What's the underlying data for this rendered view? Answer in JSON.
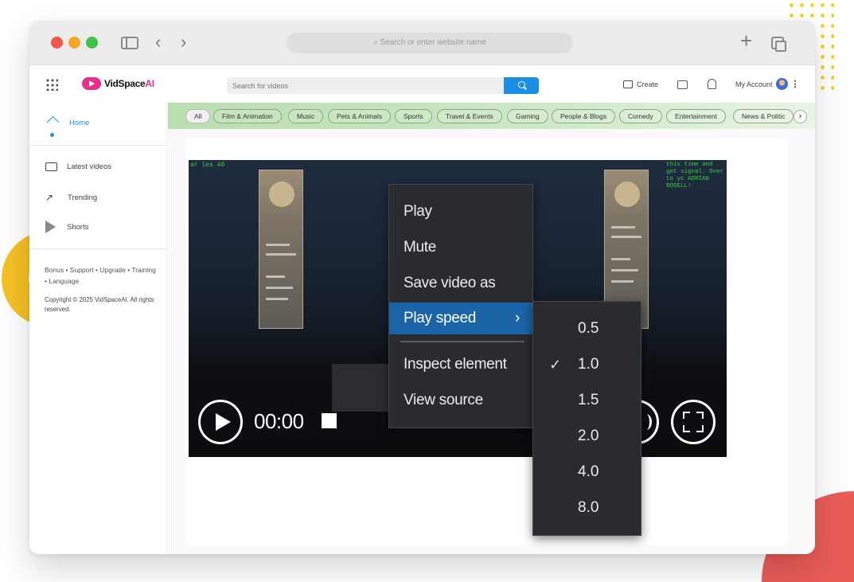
{
  "browser": {
    "url_placeholder": "Search or enter website name"
  },
  "header": {
    "logo_text": "VidSpace",
    "logo_ai": "AI",
    "search_placeholder": "Search for videos",
    "create_label": "Create",
    "account_label": "My Account"
  },
  "sidebar": {
    "items": [
      {
        "label": "Home",
        "icon": "home-icon",
        "active": true
      },
      {
        "label": "Latest videos",
        "icon": "video-icon"
      },
      {
        "label": "Trending",
        "icon": "trending-icon"
      },
      {
        "label": "Shorts",
        "icon": "shorts-icon"
      }
    ],
    "links": "Bonus • Support • Upgrade • Training • Language",
    "copyright": "Copyright © 2025 VidSpaceAI. All rights reserved."
  },
  "chips": [
    "All",
    "Film & Animation",
    "Music",
    "Pets & Animals",
    "Sports",
    "Travel & Events",
    "Gaming",
    "People & Blogs",
    "Comedy",
    "Entertainment",
    "News & Politic"
  ],
  "video": {
    "overlay_left": "ar les 40",
    "overlay_right": "this time and get signal. Over to yc ADRIAN ROSELL!",
    "time": "00:00"
  },
  "context_menu": {
    "items": [
      "Play",
      "Mute",
      "Save video as",
      "Play speed",
      "Inspect element",
      "View source"
    ],
    "highlighted": "Play speed",
    "chevron": "›"
  },
  "speed_menu": {
    "options": [
      "0.5",
      "1.0",
      "1.5",
      "2.0",
      "4.0",
      "8.0"
    ],
    "selected": "1.0",
    "check": "✓"
  },
  "colors": {
    "accent": "#1d8ee6",
    "brand": "#e62e8a",
    "menu_bg": "#2a2b2e",
    "menu_highlight": "#1b64a8"
  }
}
